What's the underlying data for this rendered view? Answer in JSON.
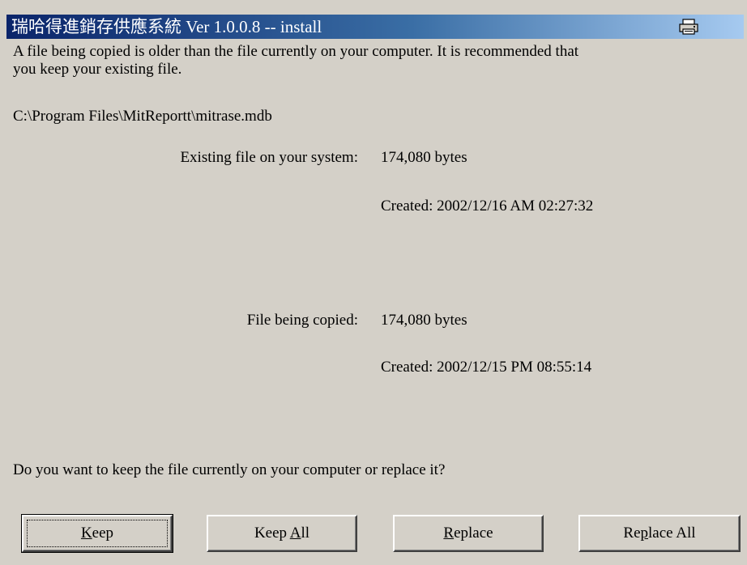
{
  "window": {
    "title": "瑞哈得進銷存供應系統 Ver 1.0.0.8 -- install",
    "title_icon": "printer-icon"
  },
  "message": {
    "line1": "A file being copied is older than the file currently on your computer.  It is recommended that",
    "line2": "you keep your existing file."
  },
  "file_path": "C:\\Program Files\\MitReportt\\mitrase.mdb",
  "existing": {
    "label": "Existing file on your system:",
    "size": "174,080 bytes",
    "created": "Created: 2002/12/16 AM 02:27:32"
  },
  "copied": {
    "label": "File being copied:",
    "size": "174,080 bytes",
    "created": "Created: 2002/12/15 PM 08:55:14"
  },
  "question": "Do you want to keep the file currently on your computer or replace it?",
  "buttons": {
    "keep": {
      "mnemonic": "K",
      "rest": "eep"
    },
    "keep_all": {
      "prefix": "Keep ",
      "mnemonic": "A",
      "rest": "ll"
    },
    "replace": {
      "mnemonic": "R",
      "rest": "eplace"
    },
    "replace_all": {
      "prefix": "Re",
      "mnemonic": "p",
      "rest": "lace All"
    }
  },
  "colors": {
    "dialog_bg": "#d4d0c8",
    "title_start": "#0a246a",
    "title_end": "#a6caf0"
  }
}
